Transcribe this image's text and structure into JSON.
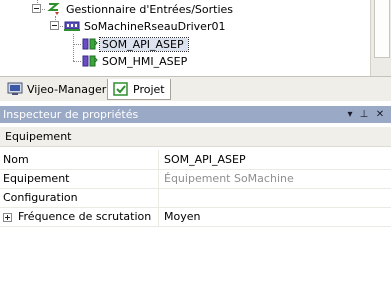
{
  "tree": {
    "items": [
      {
        "label": "Gestionnaire d'Entrées/Sorties",
        "icon": "io-manager-icon"
      },
      {
        "label": "SoMachineRseauDriver01",
        "icon": "network-driver-icon"
      },
      {
        "label": "SOM_API_ASEP",
        "icon": "device-icon",
        "selected": true
      },
      {
        "label": "SOM_HMI_ASEP",
        "icon": "device-icon"
      }
    ]
  },
  "tabs": [
    {
      "label": "Vijeo-Manager",
      "icon": "vijeo-manager-icon"
    },
    {
      "label": "Projet",
      "icon": "project-icon",
      "active": true
    }
  ],
  "inspector": {
    "title": "Inspecteur de propriétés",
    "toolbar": {
      "dropdown": "▾",
      "pin": "⊥",
      "close": "✕"
    },
    "section": "Equipement",
    "rows": [
      {
        "name": "Nom",
        "value": "SOM_API_ASEP"
      },
      {
        "name": "Equipement",
        "value": "Équipement SoMachine",
        "muted": true
      },
      {
        "name": "Configuration",
        "value": ""
      },
      {
        "name": "Fréquence de scrutation",
        "value": "Moyen",
        "expandable": true
      }
    ]
  },
  "colors": {
    "title_bar": "#9aa9c6",
    "selection": "#dde3ee",
    "muted_text": "#8f8f8f"
  }
}
